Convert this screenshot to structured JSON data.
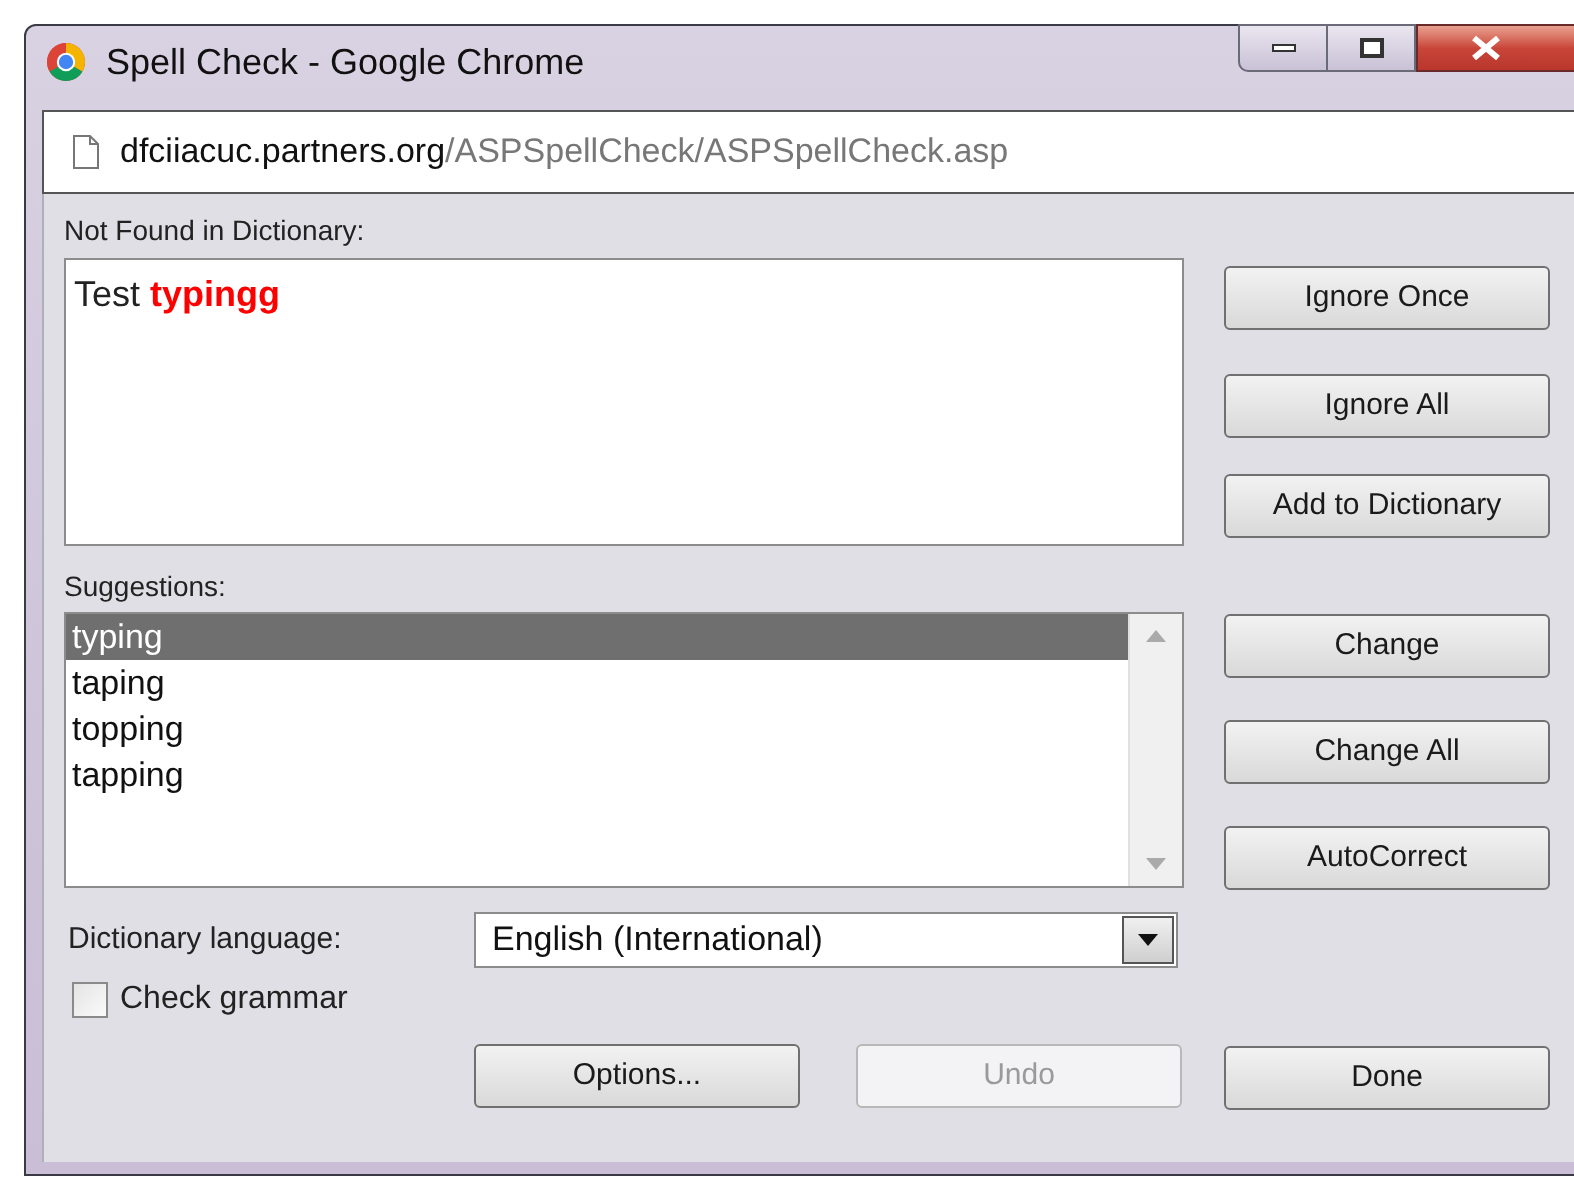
{
  "window": {
    "title": "Spell Check - Google Chrome"
  },
  "address_bar": {
    "host": "dfciiacuc.partners.org",
    "path": "/ASPSpellCheck/ASPSpellCheck.asp"
  },
  "not_found": {
    "label": "Not Found in Dictionary:",
    "context": "Test",
    "word": "typingg"
  },
  "suggestions": {
    "label": "Suggestions:",
    "items": [
      {
        "text": "typing",
        "selected": true
      },
      {
        "text": "taping",
        "selected": false
      },
      {
        "text": "topping",
        "selected": false
      },
      {
        "text": "tapping",
        "selected": false
      }
    ]
  },
  "language": {
    "label": "Dictionary language:",
    "value": "English (International)"
  },
  "check_grammar": {
    "label": "Check grammar",
    "checked": false
  },
  "ignore_buttons": [
    {
      "label": "Ignore Once",
      "disabled": false
    },
    {
      "label": "Ignore All",
      "disabled": false
    },
    {
      "label": "Add to Dictionary",
      "disabled": false
    }
  ],
  "change_buttons": [
    {
      "label": "Change",
      "disabled": false
    },
    {
      "label": "Change All",
      "disabled": false
    },
    {
      "label": "AutoCorrect",
      "disabled": false
    }
  ],
  "bottom_buttons": [
    {
      "label": "Options...",
      "disabled": false
    },
    {
      "label": "Undo",
      "disabled": true
    },
    {
      "label": "Done",
      "disabled": false
    }
  ]
}
